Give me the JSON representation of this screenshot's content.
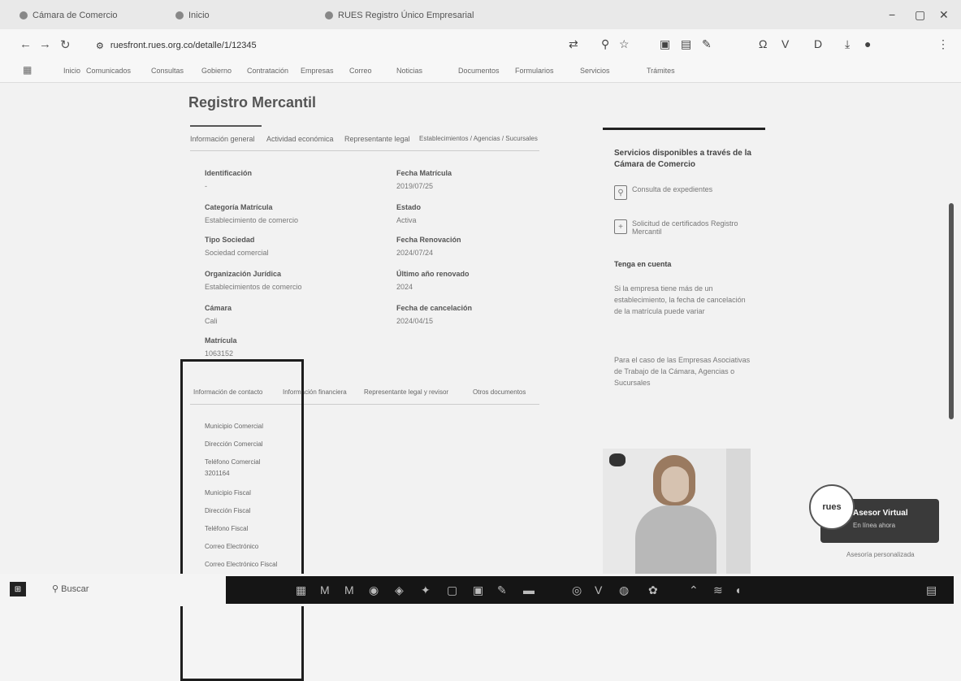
{
  "browser": {
    "tabs": [
      {
        "label": "Cámara de Comercio",
        "active": true
      },
      {
        "label": "Inicio",
        "active": false
      },
      {
        "label": "RUES Registro Único Empresarial",
        "active": false
      }
    ],
    "url": "ruesfront.rues.org.co/detalle/1/12345",
    "bookmarks": [
      "Inicio",
      "Comunicados",
      "Consultas",
      "Gobierno",
      "Contratación",
      "Empresas",
      "Correo",
      "Noticias",
      "Documentos",
      "Formularios",
      "Servicios",
      "Trámites"
    ],
    "window_controls": [
      "−",
      "▢",
      "✕"
    ]
  },
  "page": {
    "title": "Registro Mercantil",
    "tabs": [
      "Información general",
      "Actividad económica",
      "Representante legal",
      "Establecimientos / Agencias / Sucursales"
    ],
    "left_fields": [
      {
        "label": "Identificación",
        "value": "-"
      },
      {
        "label": "Categoría Matrícula",
        "value": "Establecimiento de comercio"
      },
      {
        "label": "Tipo Sociedad",
        "value": "Sociedad comercial"
      },
      {
        "label": "Organización Jurídica",
        "value": "Establecimientos de comercio"
      },
      {
        "label": "Cámara",
        "value": "Cali"
      },
      {
        "label": "Matrícula",
        "value": "1063152"
      }
    ],
    "right_fields": [
      {
        "label": "Fecha Matrícula",
        "value": "2019/07/25"
      },
      {
        "label": "Estado",
        "value": "Activa"
      },
      {
        "label": "Fecha Renovación",
        "value": "2024/07/24"
      },
      {
        "label": "Último año renovado",
        "value": "2024"
      },
      {
        "label": "Fecha de cancelación",
        "value": "2024/04/15"
      }
    ],
    "tabs2": [
      "Información de contacto",
      "Información financiera",
      "Representante legal y revisor",
      "Otros documentos"
    ],
    "contact_links": [
      "Municipio Comercial",
      "Dirección Comercial",
      "Teléfono Comercial",
      "3201164",
      "Municipio Fiscal",
      "Dirección Fiscal",
      "Teléfono Fiscal",
      "Correo Electrónico",
      "Correo Electrónico Fiscal"
    ]
  },
  "sidebar": {
    "title": "Servicios disponibles a través de la Cámara de Comercio",
    "items": [
      {
        "icon": "search-doc-icon",
        "label": "Consulta de expedientes"
      },
      {
        "icon": "download-doc-icon",
        "label": "Solicitud de certificados Registro Mercantil"
      }
    ],
    "subtitle": "Tenga en cuenta",
    "notes": [
      "Si la empresa tiene más de un establecimiento, la fecha de cancelación de la matrícula puede variar",
      "Para el caso de las Empresas Asociativas de Trabajo de la Cámara, Agencias o Sucursales"
    ]
  },
  "assistant": {
    "badge": "rues",
    "title": "Asesor Virtual",
    "subtitle": "En línea ahora",
    "caption": "Asesoría personalizada"
  },
  "taskbar": {
    "search": "Buscar",
    "start": "⊞"
  }
}
